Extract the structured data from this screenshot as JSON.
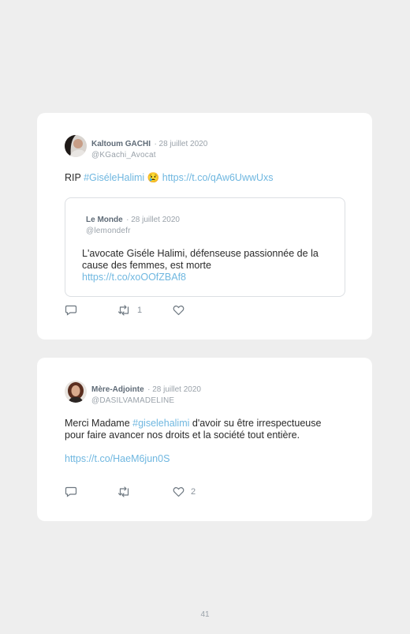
{
  "tweets": [
    {
      "author": "Kaltoum GACHI",
      "date": "· 28 juillet 2020",
      "handle": "@KGachi_Avocat",
      "text_prefix": "RIP ",
      "hashtag": "#GiséleHalimi",
      "emoji": "😢",
      "link": "https://t.co/qAw6UwwUxs",
      "quoted": {
        "author": "Le Monde",
        "date": "· 28 juillet 2020",
        "handle": "@lemondefr",
        "text": "L'avocate Giséle Halimi, défenseuse passionnée de la cause des femmes, est morte",
        "link": "https://t.co/xoOOfZBAf8"
      },
      "actions": {
        "reply_count": "",
        "retweet_count": "1",
        "like_count": ""
      }
    },
    {
      "author": "Mère-Adjointe",
      "date": "· 28 juillet 2020",
      "handle": "@DASILVAMADELINE",
      "text_prefix": "Merci Madame ",
      "hashtag": "#giselehalimi",
      "text_suffix": " d'avoir su être irrespectueuse pour faire avancer nos droits et la société tout entière.",
      "link": "https://t.co/HaeM6jun0S",
      "actions": {
        "reply_count": "",
        "retweet_count": "",
        "like_count": "2"
      }
    }
  ],
  "page_number": "41",
  "colors": {
    "link": "#6fb7e0",
    "background": "#eeeeee",
    "card": "#ffffff",
    "icon": "#6d7780"
  },
  "icons": [
    "reply-icon",
    "retweet-icon",
    "like-icon"
  ]
}
